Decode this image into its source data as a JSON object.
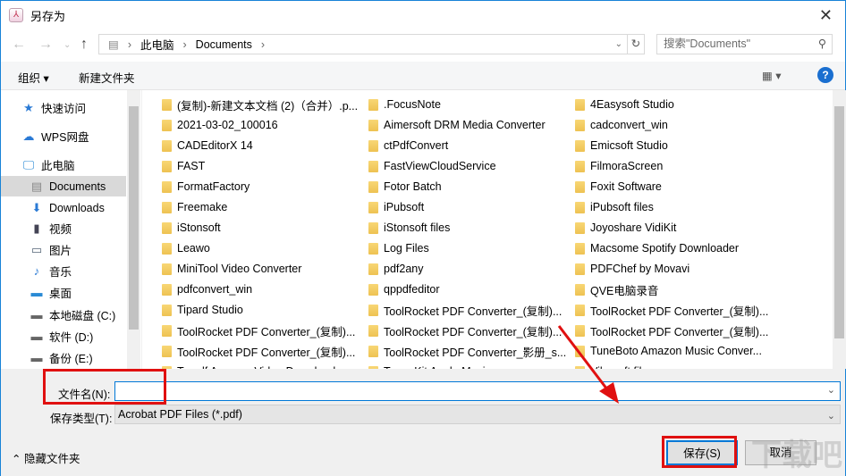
{
  "window": {
    "title": "另存为"
  },
  "address": {
    "crumbs": [
      "此电脑",
      "Documents"
    ],
    "search_placeholder": "搜索\"Documents\""
  },
  "toolbar": {
    "organize": "组织 ▾",
    "new_folder": "新建文件夹",
    "help": "?"
  },
  "sidebar": {
    "items": [
      {
        "label": "快速访问",
        "icon": "star-icon"
      },
      {
        "label": "WPS网盘",
        "icon": "cloud-icon"
      },
      {
        "label": "此电脑",
        "icon": "computer-icon"
      },
      {
        "label": "Documents",
        "icon": "document-icon",
        "selected": true
      },
      {
        "label": "Downloads",
        "icon": "download-icon"
      },
      {
        "label": "视频",
        "icon": "video-icon"
      },
      {
        "label": "图片",
        "icon": "picture-icon"
      },
      {
        "label": "音乐",
        "icon": "music-icon"
      },
      {
        "label": "桌面",
        "icon": "desktop-icon"
      },
      {
        "label": "本地磁盘 (C:)",
        "icon": "drive-icon"
      },
      {
        "label": "软件 (D:)",
        "icon": "drive-icon"
      },
      {
        "label": "备份 (E:)",
        "icon": "drive-icon"
      }
    ]
  },
  "folders": [
    "(复制)-新建文本文档 (2)（合并）.p...",
    ".FocusNote",
    "4Easysoft Studio",
    "2021-03-02_100016",
    "Aimersoft DRM Media Converter",
    "cadconvert_win",
    "CADEditorX 14",
    "ctPdfConvert",
    "Emicsoft Studio",
    "FAST",
    "FastViewCloudService",
    "FilmoraScreen",
    "FormatFactory",
    "Fotor Batch",
    "Foxit Software",
    "Freemake",
    "iPubsoft",
    "iPubsoft files",
    "iStonsoft",
    "iStonsoft files",
    "Joyoshare VidiKit",
    "Leawo",
    "Log Files",
    "Macsome Spotify Downloader",
    "MiniTool Video Converter",
    "pdf2any",
    "PDFChef by Movavi",
    "pdfconvert_win",
    "qppdfeditor",
    "QVE电脑录音",
    "Tipard Studio",
    "ToolRocket PDF Converter_(复制)...",
    "ToolRocket PDF Converter_(复制)...",
    "ToolRocket PDF Converter_(复制)...",
    "ToolRocket PDF Converter_(复制)...",
    "ToolRocket PDF Converter_(复制)...",
    "ToolRocket PDF Converter_(复制)...",
    "ToolRocket PDF Converter_影册_s...",
    "TuneBoto Amazon Music Conver...",
    "Tunelf Amazon Video Downloader",
    "TunesKit Apple Music",
    "Vibosoft files"
  ],
  "form": {
    "filename_label": "文件名(N):",
    "filename_value": "",
    "type_label": "保存类型(T):",
    "type_value": "Acrobat PDF Files (*.pdf)"
  },
  "footer": {
    "hide_folders": "隐藏文件夹",
    "save": "保存(S)",
    "cancel": "取消"
  }
}
